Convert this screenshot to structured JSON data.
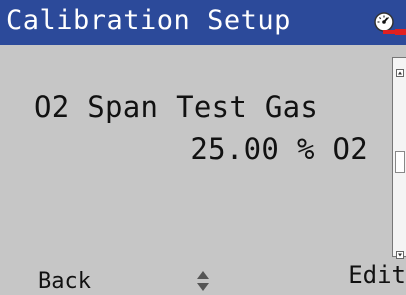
{
  "header": {
    "title": "Calibration Setup",
    "status_icon": "gauge-alarm-icon",
    "status_color": "#e02020"
  },
  "parameter": {
    "label": "O2 Span Test Gas",
    "value": "25.00 % O2"
  },
  "softkeys": {
    "left_label": "Back",
    "center_icon": "up-down-arrows-icon",
    "right_label": "Edit"
  },
  "colors": {
    "title_bar": "#2c4a9a",
    "background": "#c6c6c6"
  }
}
